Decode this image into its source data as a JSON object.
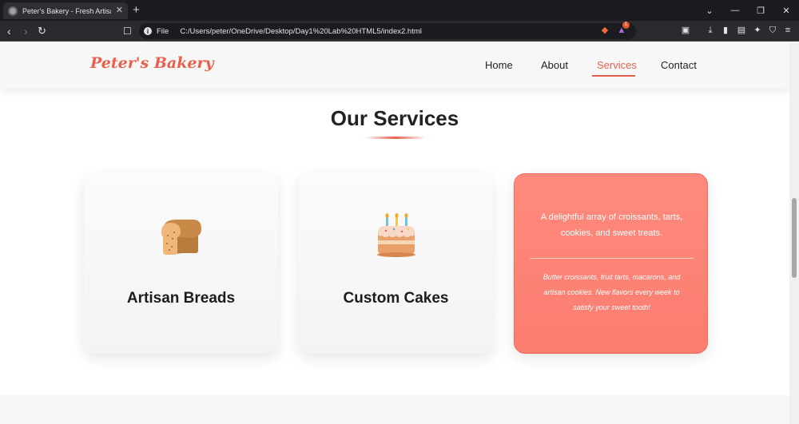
{
  "browser": {
    "tab_title": "Peter's Bakery - Fresh Artisan Bre",
    "url_scheme": "File",
    "url": "C:/Users/peter/OneDrive/Desktop/Day1%20Lab%20HTML5/index2.html",
    "extension_badge_count": "1"
  },
  "site": {
    "logo": "Peter's Bakery",
    "nav": [
      {
        "label": "Home",
        "active": false
      },
      {
        "label": "About",
        "active": false
      },
      {
        "label": "Services",
        "active": true
      },
      {
        "label": "Contact",
        "active": false
      }
    ]
  },
  "services": {
    "title": "Our Services",
    "cards": [
      {
        "title": "Artisan Breads",
        "icon": "bread-icon"
      },
      {
        "title": "Custom Cakes",
        "icon": "cake-icon"
      },
      {
        "flipped": true,
        "description": "A delightful array of croissants, tarts, cookies, and sweet treats.",
        "detail": "Butter croissants, fruit tarts, macarons, and artisan cookies. New flavors every week to satisfy your sweet tooth!"
      }
    ]
  },
  "colors": {
    "accent": "#e8604c",
    "flipped_card": "#fb7d70"
  }
}
